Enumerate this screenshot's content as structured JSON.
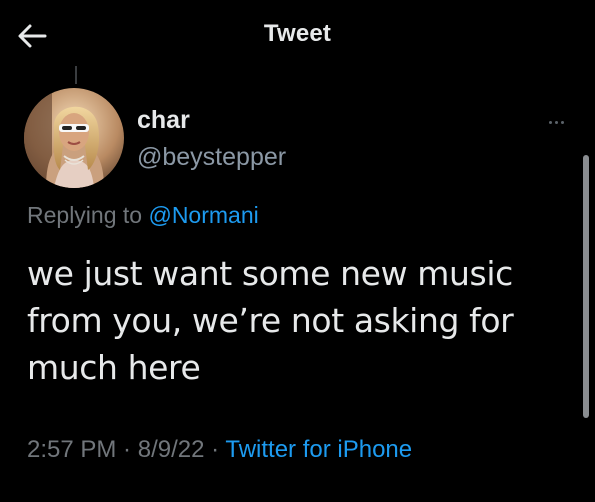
{
  "header": {
    "title": "Tweet",
    "back_icon": "arrow-left-icon"
  },
  "tweet": {
    "author": {
      "display_name": "char",
      "handle": "@beystepper"
    },
    "replying_prefix": "Replying to ",
    "replying_to": "@Normani",
    "text": "we just want some new music from you, we’re not asking for much here",
    "time": "2:57 PM",
    "separator": " · ",
    "date": "8/9/22",
    "source": "Twitter for iPhone",
    "more_icon": "more-horizontal-icon"
  },
  "colors": {
    "background": "#000000",
    "text_primary": "#e7e9ea",
    "text_secondary": "#71767b",
    "accent": "#1d9bf0"
  }
}
